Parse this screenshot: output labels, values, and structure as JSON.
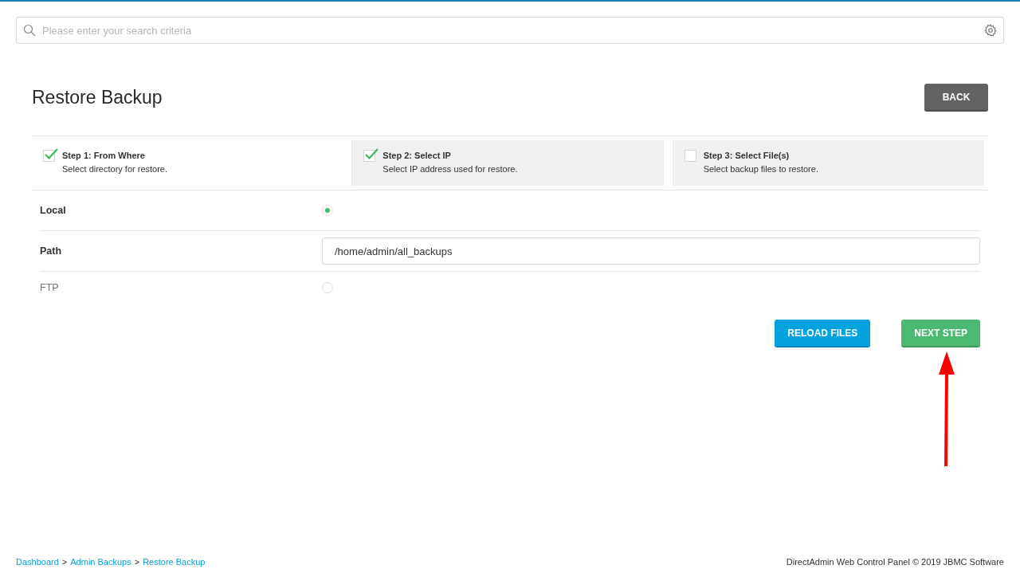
{
  "search": {
    "placeholder": "Please enter your search criteria"
  },
  "page": {
    "title": "Restore Backup",
    "back_button": "BACK"
  },
  "steps": [
    {
      "title": "Step 1: From Where",
      "description": "Select directory for restore.",
      "checked": true,
      "selected": true
    },
    {
      "title": "Step 2: Select IP",
      "description": "Select IP address used for restore.",
      "checked": true,
      "selected": false
    },
    {
      "title": "Step 3: Select File(s)",
      "description": "Select backup files to restore.",
      "checked": false,
      "selected": false
    }
  ],
  "form_rows": [
    {
      "kind": "radio",
      "label": "Local",
      "selected": true
    },
    {
      "kind": "input",
      "label": "Path",
      "value": "/home/admin/all_backups"
    },
    {
      "kind": "radio",
      "label": "FTP",
      "selected": false
    }
  ],
  "actions": [
    {
      "label": "RELOAD FILES",
      "kind": "primary"
    },
    {
      "label": "NEXT STEP",
      "kind": "success"
    }
  ],
  "breadcrumb": {
    "separator": ">",
    "items": [
      "Dashboard",
      "Admin Backups",
      "Restore Backup"
    ]
  },
  "footer": {
    "text": "DirectAdmin Web Control Panel © 2019 JBMC Software"
  }
}
